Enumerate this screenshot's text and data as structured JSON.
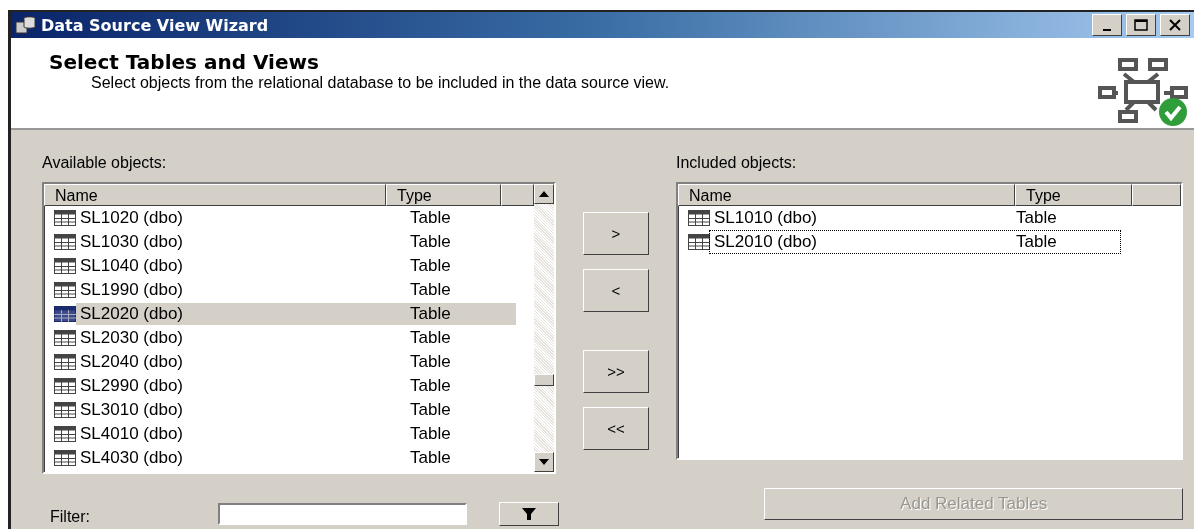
{
  "window": {
    "title": "Data Source View Wizard"
  },
  "header": {
    "title": "Select Tables and Views",
    "description": "Select objects from the relational database to be included in the data source view."
  },
  "available": {
    "label": "Available objects:",
    "columns": [
      "Name",
      "Type"
    ],
    "rows": [
      {
        "name": "SL1020 (dbo)",
        "type": "Table",
        "selected": false
      },
      {
        "name": "SL1030 (dbo)",
        "type": "Table",
        "selected": false
      },
      {
        "name": "SL1040 (dbo)",
        "type": "Table",
        "selected": false
      },
      {
        "name": "SL1990 (dbo)",
        "type": "Table",
        "selected": false
      },
      {
        "name": "SL2020 (dbo)",
        "type": "Table",
        "selected": true
      },
      {
        "name": "SL2030 (dbo)",
        "type": "Table",
        "selected": false
      },
      {
        "name": "SL2040 (dbo)",
        "type": "Table",
        "selected": false
      },
      {
        "name": "SL2990 (dbo)",
        "type": "Table",
        "selected": false
      },
      {
        "name": "SL3010 (dbo)",
        "type": "Table",
        "selected": false
      },
      {
        "name": "SL4010 (dbo)",
        "type": "Table",
        "selected": false
      },
      {
        "name": "SL4030 (dbo)",
        "type": "Table",
        "selected": false
      }
    ]
  },
  "move_buttons": [
    ">",
    "<",
    ">>",
    "<<"
  ],
  "included": {
    "label": "Included objects:",
    "columns": [
      "Name",
      "Type"
    ],
    "rows": [
      {
        "name": "SL1010 (dbo)",
        "type": "Table",
        "focused": false
      },
      {
        "name": "SL2010 (dbo)",
        "type": "Table",
        "focused": true
      }
    ]
  },
  "filter": {
    "label": "Filter:"
  },
  "add_related": {
    "label": "Add Related Tables",
    "disabled": true
  }
}
